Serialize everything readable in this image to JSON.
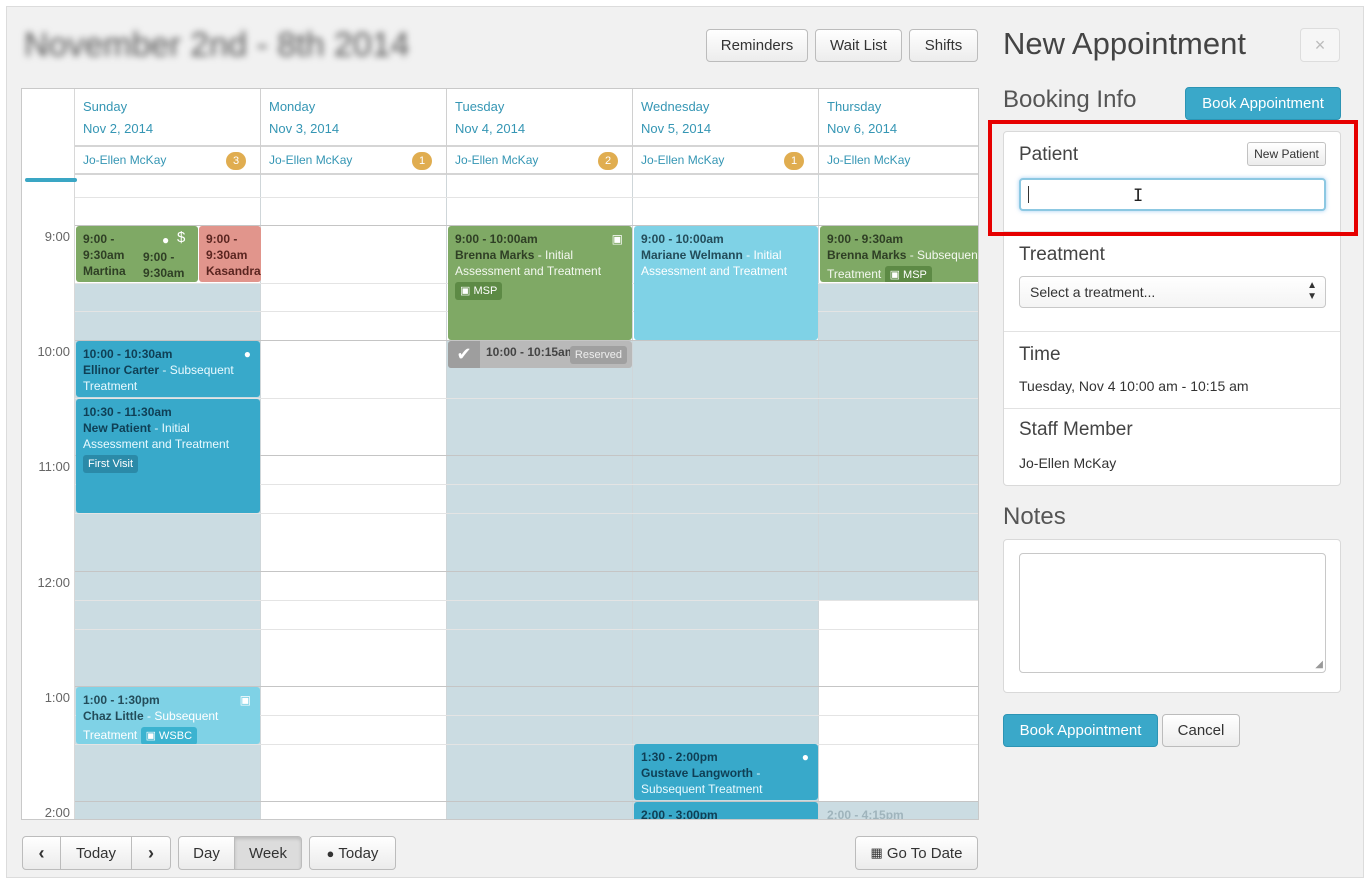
{
  "header": {
    "title": "November 2nd - 8th 2014",
    "buttons": {
      "reminders": "Reminders",
      "wait_list": "Wait List",
      "shifts": "Shifts"
    }
  },
  "calendar": {
    "times": [
      "9:00",
      "10:00",
      "11:00",
      "12:00",
      "1:00",
      "2:00"
    ],
    "days": [
      {
        "name": "Sunday",
        "date": "Nov 2, 2014",
        "staff": "Jo-Ellen McKay",
        "count": "3"
      },
      {
        "name": "Monday",
        "date": "Nov 3, 2014",
        "staff": "Jo-Ellen McKay",
        "count": "1"
      },
      {
        "name": "Tuesday",
        "date": "Nov 4, 2014",
        "staff": "Jo-Ellen McKay",
        "count": "2"
      },
      {
        "name": "Wednesday",
        "date": "Nov 5, 2014",
        "staff": "Jo-Ellen McKay",
        "count": "1"
      },
      {
        "name": "Thursday",
        "date": "Nov 6, 2014",
        "staff": "Jo-Ellen McKay",
        "count": ""
      }
    ],
    "appointments": {
      "sun_martina_time": "9:00 - 9:30am",
      "sun_martina_name": "Martina",
      "sun_mid_time": "9:00 - 9:30am",
      "sun_kasandra_time": "9:00 - 9:30am",
      "sun_kasandra_name": "Kasandra",
      "sun_ellinor_time": "10:00 - 10:30am",
      "sun_ellinor_name": "Ellinor Carter",
      "sun_ellinor_desc": " - Subsequent Treatment",
      "sun_new_time": "10:30 - 11:30am",
      "sun_new_name": "New Patient",
      "sun_new_desc": " - Initial Assessment and Treatment",
      "sun_new_tag": "First Visit",
      "sun_chaz_time": "1:00 - 1:30pm",
      "sun_chaz_name": "Chaz Little",
      "sun_chaz_desc": " - Subsequent Treatment",
      "sun_chaz_tag": "WSBC",
      "tue_brenna_time": "9:00 - 10:00am",
      "tue_brenna_name": "Brenna Marks",
      "tue_brenna_desc": " - Initial Assessment and Treatment",
      "tue_brenna_tag": "MSP",
      "tue_reserved_time": "10:00 - 10:15am",
      "tue_reserved_label": "Reserved",
      "wed_mariane_time": "9:00 - 10:00am",
      "wed_mariane_name": "Mariane Welmann",
      "wed_mariane_desc": " - Initial Assessment and Treatment",
      "wed_gustave_time": "1:30 - 2:00pm",
      "wed_gustave_name": "Gustave Langworth",
      "wed_gustave_desc": " - Subsequent Treatment",
      "wed_next_time": "2:00 - 3:00pm",
      "thu_brenna_time": "9:00 - 9:30am",
      "thu_brenna_name": "Brenna Marks",
      "thu_brenna_desc": " - Subsequent Treatment",
      "thu_brenna_tag": "MSP",
      "thu_next_time": "2:00 - 4:15pm"
    }
  },
  "footer": {
    "today": "Today",
    "day": "Day",
    "week": "Week",
    "my_today": "Today",
    "go_to_date": "Go To Date"
  },
  "panel": {
    "title": "New Appointment",
    "close": "×",
    "booking_info": "Booking Info",
    "book_top": "Book Appointment",
    "patient_label": "Patient",
    "new_patient": "New Patient",
    "patient_value": "",
    "treatment_label": "Treatment",
    "treatment_placeholder": "Select a treatment...",
    "time_label": "Time",
    "time_value": "Tuesday, Nov 4 10:00 am - 10:15 am",
    "staff_label": "Staff Member",
    "staff_value": "Jo-Ellen McKay",
    "notes_label": "Notes",
    "notes_value": "",
    "book_bottom": "Book Appointment",
    "cancel": "Cancel"
  },
  "colors": {
    "accent": "#3aa8c9",
    "green_appt": "#7fa965",
    "blue_appt": "#38a9ca",
    "light_blue_appt": "#7fd2e6",
    "pink_appt": "#e1958c",
    "count_badge": "#e0ad50",
    "highlight": "#e60000"
  }
}
